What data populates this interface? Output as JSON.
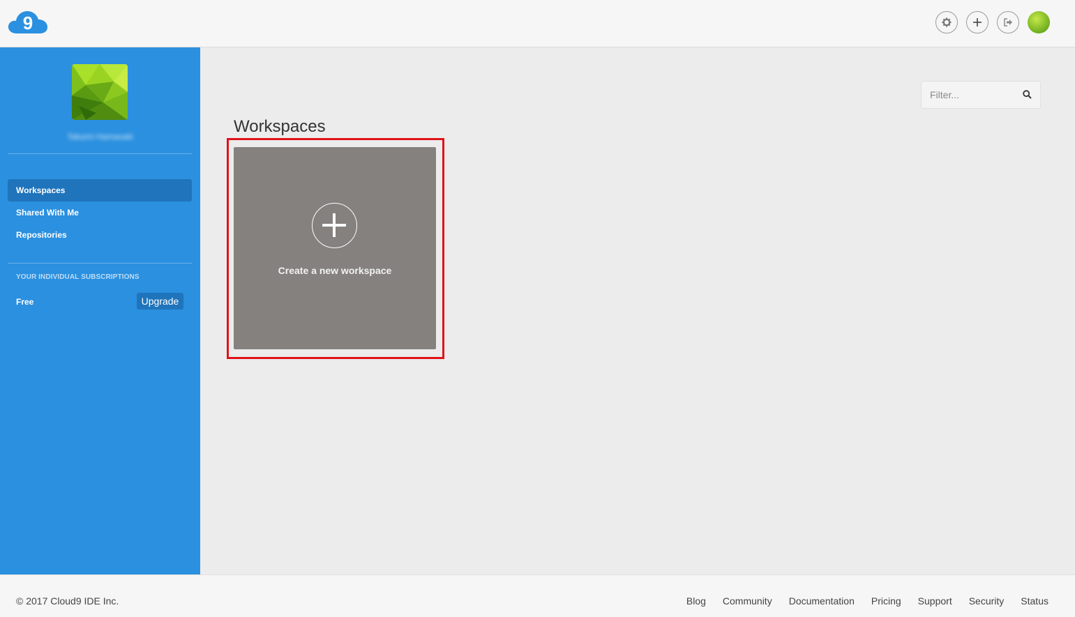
{
  "header": {
    "logo_icon": "cloud9-logo-icon",
    "actions": [
      {
        "name": "settings-button",
        "icon": "gear-icon"
      },
      {
        "name": "create-button",
        "icon": "plus-icon"
      },
      {
        "name": "logout-button",
        "icon": "sign-out-icon"
      }
    ]
  },
  "sidebar": {
    "username": "Takumi Hamasaki",
    "nav": [
      {
        "label": "Workspaces",
        "active": true
      },
      {
        "label": "Shared With Me",
        "active": false
      },
      {
        "label": "Repositories",
        "active": false
      }
    ],
    "subscriptions_heading": "YOUR INDIVIDUAL SUBSCRIPTIONS",
    "plan": "Free",
    "upgrade_label": "Upgrade"
  },
  "main": {
    "filter_placeholder": "Filter...",
    "title": "Workspaces",
    "new_workspace_label": "Create a new workspace",
    "highlight_color": "#e0131a"
  },
  "footer": {
    "copyright": "© 2017 Cloud9 IDE Inc.",
    "links": [
      "Blog",
      "Community",
      "Documentation",
      "Pricing",
      "Support",
      "Security",
      "Status"
    ]
  },
  "colors": {
    "sidebar": "#2b90df",
    "sidebar_active": "#1f74bb",
    "tile": "#84817e"
  }
}
